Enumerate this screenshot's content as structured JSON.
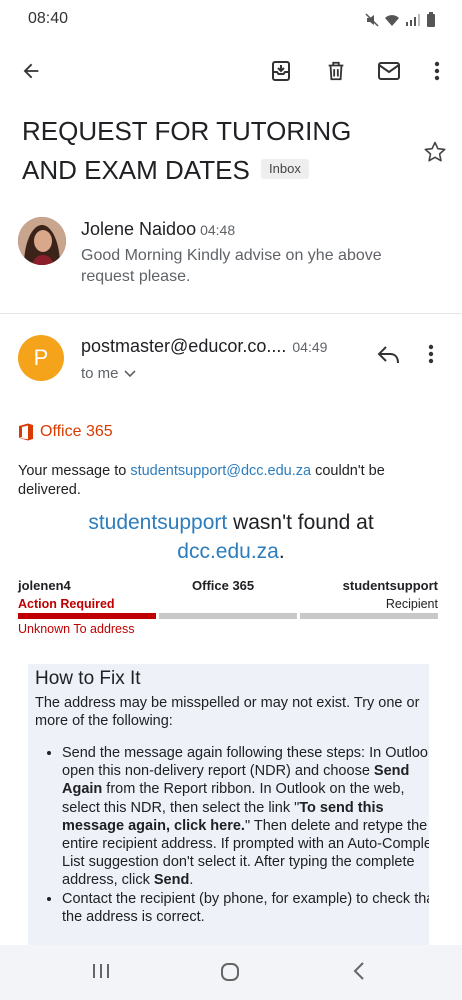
{
  "status": {
    "time": "08:40"
  },
  "subject": {
    "title": "REQUEST FOR TUTORING AND EXAM DATES",
    "badge": "Inbox"
  },
  "message1": {
    "sender": "Jolene Naidoo",
    "time": "04:48",
    "snippet": "Good Morning Kindly advise on yhe above request please."
  },
  "message2": {
    "avatar_letter": "P",
    "sender": "postmaster@educor.co....",
    "time": "04:49",
    "recipient_label": "to me"
  },
  "ndr": {
    "brand": "Office 365",
    "intro_pre": "Your message to ",
    "intro_link": "studentsupport@dcc.edu.za",
    "intro_post": " couldn't be delivered.",
    "nf_user": "studentsupport",
    "nf_mid": " wasn't found at",
    "nf_domain": "dcc.edu.za",
    "nf_end": ".",
    "col1_title": "jolenen4",
    "col1_status": "Action Required",
    "col2_title": "Office 365",
    "col3_title": "studentsupport",
    "col3_status": "Recipient",
    "error": "Unknown To address",
    "colors": {
      "action": "#c00000",
      "bar_inactive": "#c8c8c8",
      "link": "#2d7dbd",
      "brand": "#d83b01"
    }
  },
  "fix": {
    "title": "How to Fix It",
    "intro": "The address may be misspelled or may not exist. Try one or more of the following:",
    "b1_a": "Send the message again following these steps: In Outlook, open this non-delivery report (NDR) and choose ",
    "b1_b": "Send Again",
    "b1_c": " from the Report ribbon. In Outlook on the web, select this NDR, then select the link \"",
    "b1_d": "To send this message again, click here.",
    "b1_e": "\" Then delete and retype the entire recipient address. If prompted with an Auto-Complete List suggestion don't select it. After typing the complete address, click ",
    "b1_f": "Send",
    "b1_g": ".",
    "b2": "Contact the recipient (by phone, for example) to check that the address is correct."
  },
  "icons": [
    "back-icon",
    "archive-icon",
    "delete-icon",
    "mark-unread-icon",
    "more-vert-icon",
    "star-icon",
    "reply-icon",
    "chevron-down-icon",
    "office-logo-icon",
    "recents-icon",
    "home-icon",
    "nav-back-icon"
  ]
}
